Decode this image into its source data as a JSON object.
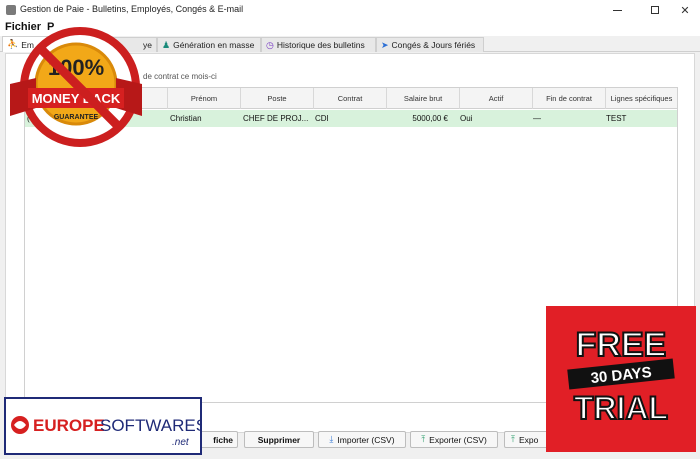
{
  "window": {
    "title": "Gestion de Paie - Bulletins, Employés, Congés & E-mail",
    "minimize_label": "",
    "maximize_label": "",
    "close_label": "✕"
  },
  "menu": {
    "file_label": "Fichier",
    "second_label": "P"
  },
  "tabs": [
    {
      "label": "Em",
      "icon": "person-icon"
    },
    {
      "label": "ye",
      "icon": "payslip-icon"
    },
    {
      "label": "Génération en masse",
      "icon": "people-icon"
    },
    {
      "label": "Historique des bulletins",
      "icon": "clock-icon"
    },
    {
      "label": "Congés & Jours fériés",
      "icon": "plane-icon"
    }
  ],
  "filter_text": "de contrat ce mois-ci",
  "table": {
    "columns": [
      "Prénom",
      "Poste",
      "Contrat",
      "Salaire brut",
      "Actif",
      "Fin de contrat",
      "Lignes spécifiques"
    ],
    "rows": [
      {
        "first_prefix": "(",
        "prenom": "Christian",
        "poste": "CHEF DE PROJ...",
        "contrat": "CDI",
        "salaire": "5000,00 €",
        "actif": "Oui",
        "fin": "—",
        "lignes": "TEST"
      }
    ]
  },
  "buttons": {
    "fiche": "fiche",
    "supprimer": "Supprimer",
    "importer": "Importer (CSV)",
    "exporter": "Exporter (CSV)",
    "expo2": "Expo"
  },
  "overlays": {
    "guarantee": {
      "top": "100%",
      "middle": "MONEY BACK",
      "bottom": "GUARANTEE"
    },
    "trial": {
      "line1": "FREE",
      "line2": "30 DAYS",
      "line3": "TRIAL"
    },
    "logo": {
      "part1": "EUROPE",
      "part2": "SOFTWARES",
      "suffix": ".net"
    }
  },
  "colors": {
    "row_highlight": "#d8f2dc",
    "trial_red": "#e11f26",
    "badge_red": "#cc1f1f",
    "badge_gold": "#f2a818",
    "logo_blue": "#1f2a77"
  }
}
